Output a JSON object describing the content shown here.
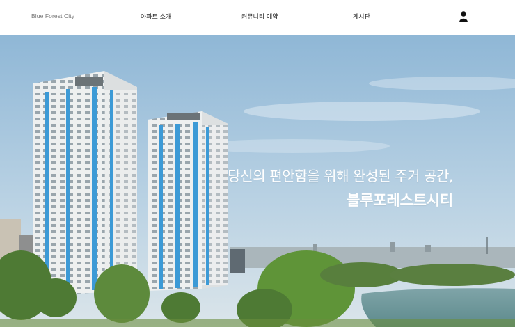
{
  "header": {
    "logo": "Blue Forest City",
    "nav": [
      {
        "label": "아파트 소개"
      },
      {
        "label": "커뮤니티 예약"
      },
      {
        "label": "게시판"
      }
    ],
    "user_icon": "user-icon"
  },
  "hero": {
    "headline_line1": "당신의 편안함을 위해 완성된 주거 공간,",
    "headline_line2": "블루포레스트시티"
  }
}
